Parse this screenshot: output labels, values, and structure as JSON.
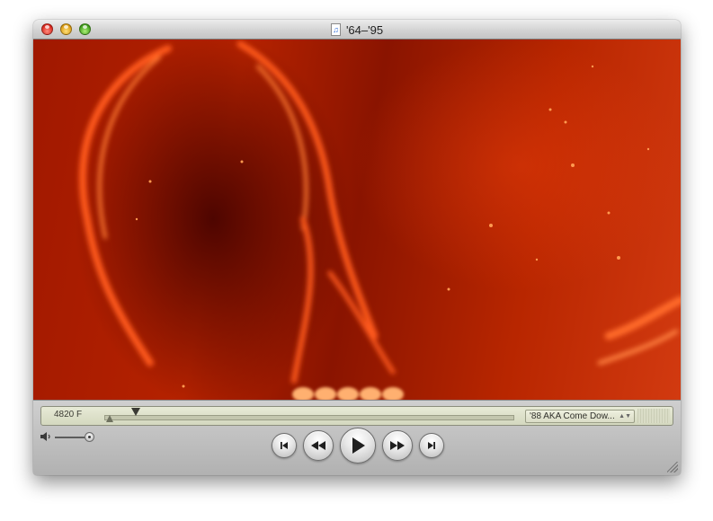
{
  "window": {
    "title": "'64–'95",
    "title_icon": "audio-document-icon"
  },
  "video": {
    "description_hidden": ""
  },
  "controls": {
    "timecode": "4820 F",
    "chapter": "'88 AKA Come Dow...",
    "chapter_arrows": "▲▼",
    "buttons": {
      "previous": "⏮",
      "rewind": "◀◀",
      "play": "▶",
      "fast_forward": "▶▶",
      "next": "⏭"
    },
    "volume_level": 0.85,
    "playhead_position": 0.07
  },
  "colors": {
    "lcd_background": "#dcdfc9",
    "video_tint": "#b52200"
  }
}
